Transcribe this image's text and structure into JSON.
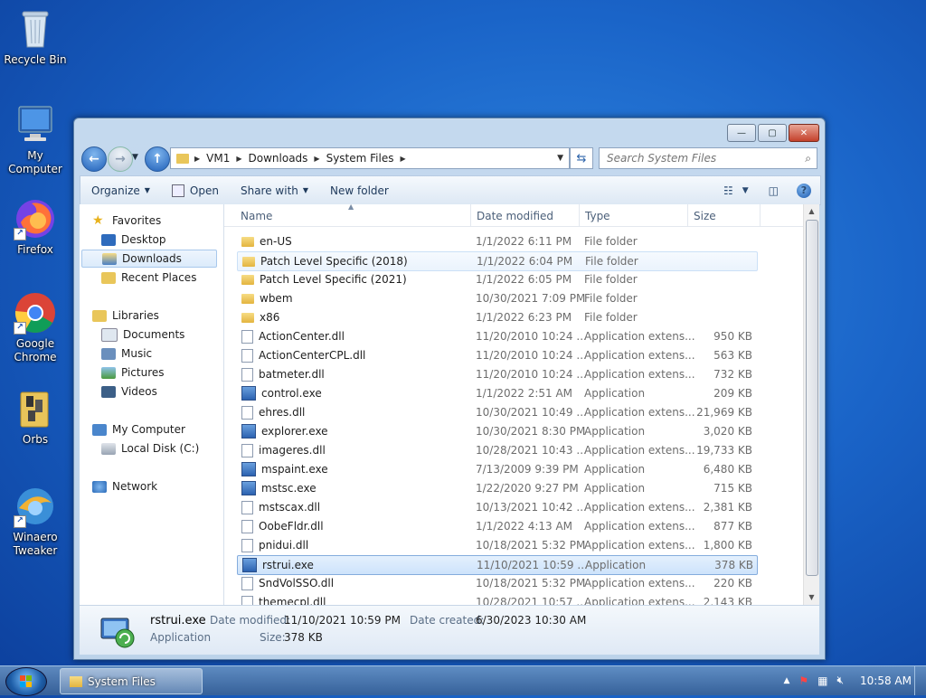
{
  "desktop": {
    "icons": [
      {
        "label": "Recycle Bin"
      },
      {
        "label": "My Computer"
      },
      {
        "label": "Firefox"
      },
      {
        "label_line1": "Google",
        "label_line2": "Chrome"
      },
      {
        "label": "Orbs"
      },
      {
        "label_line1": "Winaero",
        "label_line2": "Tweaker"
      }
    ]
  },
  "window": {
    "buttons": {
      "minimize": "—",
      "maximize": "▢",
      "close": "✕"
    },
    "address": {
      "segments": [
        "VM1",
        "Downloads",
        "System Files"
      ]
    },
    "search": {
      "placeholder": "Search System Files"
    },
    "commands": {
      "organize": "Organize",
      "open": "Open",
      "share_with": "Share with",
      "new_folder": "New folder"
    },
    "nav": {
      "favorites": "Favorites",
      "desktop": "Desktop",
      "downloads": "Downloads",
      "recent_places": "Recent Places",
      "libraries": "Libraries",
      "documents": "Documents",
      "music": "Music",
      "pictures": "Pictures",
      "videos": "Videos",
      "my_computer": "My Computer",
      "local_disk": "Local Disk (C:)",
      "network": "Network"
    },
    "columns": {
      "name": "Name",
      "date": "Date modified",
      "type": "Type",
      "size": "Size"
    },
    "files": [
      {
        "name": "en-US",
        "date": "1/1/2022 6:11 PM",
        "type": "File folder",
        "size": "",
        "kind": "folder"
      },
      {
        "name": "Patch Level Specific (2018)",
        "date": "1/1/2022 6:04 PM",
        "type": "File folder",
        "size": "",
        "kind": "folder",
        "state": "hover"
      },
      {
        "name": "Patch Level Specific (2021)",
        "date": "1/1/2022 6:05 PM",
        "type": "File folder",
        "size": "",
        "kind": "folder"
      },
      {
        "name": "wbem",
        "date": "10/30/2021 7:09 PM",
        "type": "File folder",
        "size": "",
        "kind": "folder"
      },
      {
        "name": "x86",
        "date": "1/1/2022 6:23 PM",
        "type": "File folder",
        "size": "",
        "kind": "folder"
      },
      {
        "name": "ActionCenter.dll",
        "date": "11/20/2010 10:24 ...",
        "type": "Application extens...",
        "size": "950 KB",
        "kind": "dll"
      },
      {
        "name": "ActionCenterCPL.dll",
        "date": "11/20/2010 10:24 ...",
        "type": "Application extens...",
        "size": "563 KB",
        "kind": "dll"
      },
      {
        "name": "batmeter.dll",
        "date": "11/20/2010 10:24 ...",
        "type": "Application extens...",
        "size": "732 KB",
        "kind": "dll"
      },
      {
        "name": "control.exe",
        "date": "1/1/2022 2:51 AM",
        "type": "Application",
        "size": "209 KB",
        "kind": "exe"
      },
      {
        "name": "ehres.dll",
        "date": "10/30/2021 10:49 ...",
        "type": "Application extens...",
        "size": "21,969 KB",
        "kind": "dll"
      },
      {
        "name": "explorer.exe",
        "date": "10/30/2021 8:30 PM",
        "type": "Application",
        "size": "3,020 KB",
        "kind": "exe"
      },
      {
        "name": "imageres.dll",
        "date": "10/28/2021 10:43 ...",
        "type": "Application extens...",
        "size": "19,733 KB",
        "kind": "dll"
      },
      {
        "name": "mspaint.exe",
        "date": "7/13/2009 9:39 PM",
        "type": "Application",
        "size": "6,480 KB",
        "kind": "exe"
      },
      {
        "name": "mstsc.exe",
        "date": "1/22/2020 9:27 PM",
        "type": "Application",
        "size": "715 KB",
        "kind": "exe"
      },
      {
        "name": "mstscax.dll",
        "date": "10/13/2021 10:42 ...",
        "type": "Application extens...",
        "size": "2,381 KB",
        "kind": "dll"
      },
      {
        "name": "OobeFldr.dll",
        "date": "1/1/2022 4:13 AM",
        "type": "Application extens...",
        "size": "877 KB",
        "kind": "dll"
      },
      {
        "name": "pnidui.dll",
        "date": "10/18/2021 5:32 PM",
        "type": "Application extens...",
        "size": "1,800 KB",
        "kind": "dll"
      },
      {
        "name": "rstrui.exe",
        "date": "11/10/2021 10:59 ...",
        "type": "Application",
        "size": "378 KB",
        "kind": "exe",
        "state": "selected"
      },
      {
        "name": "SndVolSSO.dll",
        "date": "10/18/2021 5:32 PM",
        "type": "Application extens...",
        "size": "220 KB",
        "kind": "dll"
      },
      {
        "name": "themecpl.dll",
        "date": "10/28/2021 10:57 ...",
        "type": "Application extens...",
        "size": "2,143 KB",
        "kind": "dll"
      }
    ],
    "details": {
      "name": "rstrui.exe",
      "type": "Application",
      "date_modified_label": "Date modified:",
      "date_modified": "11/10/2021 10:59 PM",
      "date_created_label": "Date created:",
      "date_created": "6/30/2023 10:30 AM",
      "size_label": "Size:",
      "size": "378 KB"
    }
  },
  "taskbar": {
    "task_label": "System Files",
    "clock": "10:58 AM"
  }
}
